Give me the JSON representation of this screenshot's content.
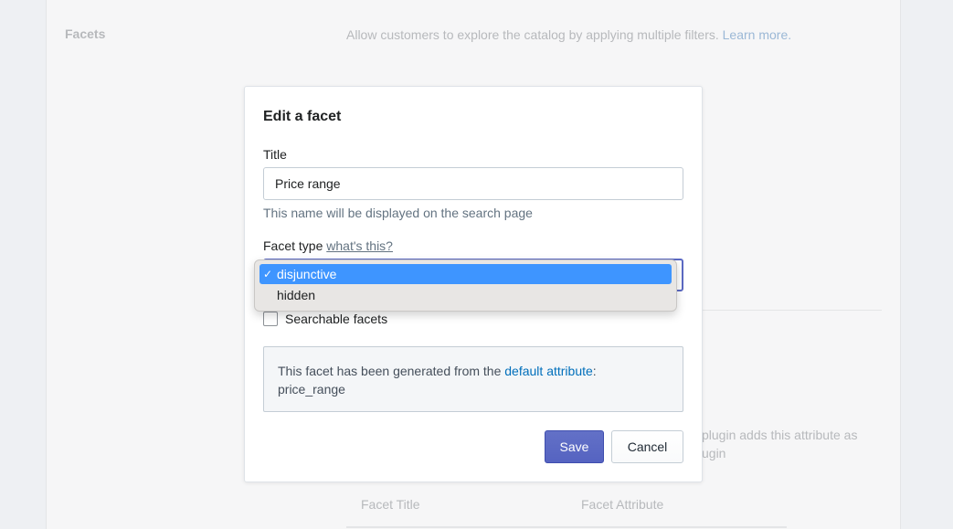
{
  "background": {
    "section_title": "Facets",
    "description": "Allow customers to explore the catalog by applying multiple filters.",
    "learn_more": "Learn more.",
    "plugin_text_line1": "plugin adds this attribute as",
    "plugin_text_line2": "ugin",
    "columns": {
      "facet_title": "Facet Title",
      "facet_attribute": "Facet Attribute"
    }
  },
  "modal": {
    "title": "Edit a facet",
    "title_label": "Title",
    "title_value": "Price range",
    "title_help": "This name will be displayed on the search page",
    "facet_type_label": "Facet type",
    "whats_this": "what's this?",
    "facet_type_options": [
      {
        "label": "disjunctive",
        "selected": true
      },
      {
        "label": "hidden",
        "selected": false
      }
    ],
    "checkbox_label": "Searchable facets",
    "checkbox_checked": false,
    "info_prefix": "This facet has been generated from the",
    "info_link": "default attribute",
    "info_suffix": ":",
    "info_attribute": "price_range",
    "save_label": "Save",
    "cancel_label": "Cancel"
  },
  "dropdown": {
    "check_glyph": "✓"
  },
  "colors": {
    "accent": "#5c6ac4",
    "selection": "#3e95ff",
    "link": "#006fbb"
  }
}
